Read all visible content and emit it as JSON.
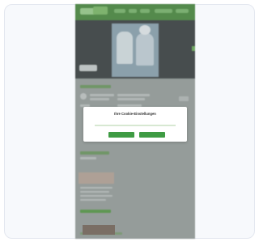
{
  "cookie_dialog": {
    "title": "Ihre Cookie-Einstellungen",
    "text": "",
    "accept_all_label": "",
    "accept_selected_label": ""
  },
  "colors": {
    "brand_green": "#4e8c43",
    "button_green": "#3e9b43",
    "card_border": "#e3e7ef"
  }
}
